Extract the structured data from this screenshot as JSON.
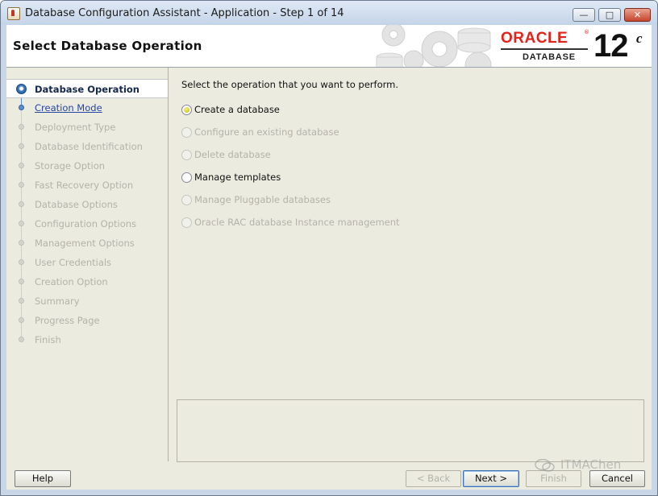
{
  "window": {
    "title": "Database Configuration Assistant - Application - Step 1 of 14",
    "controls": {
      "minimize": "—",
      "maximize": "□",
      "close": "✕"
    }
  },
  "header": {
    "title": "Select Database Operation",
    "logo": {
      "brand": "ORACLE",
      "registered": "®",
      "product": "DATABASE",
      "version": "12",
      "version_suffix": "c"
    }
  },
  "steps": [
    {
      "label": "Database Operation",
      "state": "current"
    },
    {
      "label": "Creation Mode",
      "state": "link"
    },
    {
      "label": "Deployment Type",
      "state": "disabled"
    },
    {
      "label": "Database Identification",
      "state": "disabled"
    },
    {
      "label": "Storage Option",
      "state": "disabled"
    },
    {
      "label": "Fast Recovery Option",
      "state": "disabled"
    },
    {
      "label": "Database Options",
      "state": "disabled"
    },
    {
      "label": "Configuration Options",
      "state": "disabled"
    },
    {
      "label": "Management Options",
      "state": "disabled"
    },
    {
      "label": "User Credentials",
      "state": "disabled"
    },
    {
      "label": "Creation Option",
      "state": "disabled"
    },
    {
      "label": "Summary",
      "state": "disabled"
    },
    {
      "label": "Progress Page",
      "state": "disabled"
    },
    {
      "label": "Finish",
      "state": "disabled"
    }
  ],
  "content": {
    "prompt": "Select the operation that you want to perform.",
    "options": [
      {
        "label": "Create a database",
        "checked": true,
        "enabled": true
      },
      {
        "label": "Configure an existing database",
        "checked": false,
        "enabled": false
      },
      {
        "label": "Delete database",
        "checked": false,
        "enabled": false
      },
      {
        "label": "Manage templates",
        "checked": false,
        "enabled": true
      },
      {
        "label": "Manage Pluggable databases",
        "checked": false,
        "enabled": false
      },
      {
        "label": "Oracle RAC database Instance management",
        "checked": false,
        "enabled": false
      }
    ]
  },
  "buttons": {
    "help": "Help",
    "back": "< Back",
    "next": "Next >",
    "finish": "Finish",
    "cancel": "Cancel"
  },
  "watermark": {
    "text": "ITMAChen"
  },
  "colors": {
    "accent_red": "#e2231a",
    "link_blue": "#2546a3",
    "panel": "#ecebe0"
  }
}
